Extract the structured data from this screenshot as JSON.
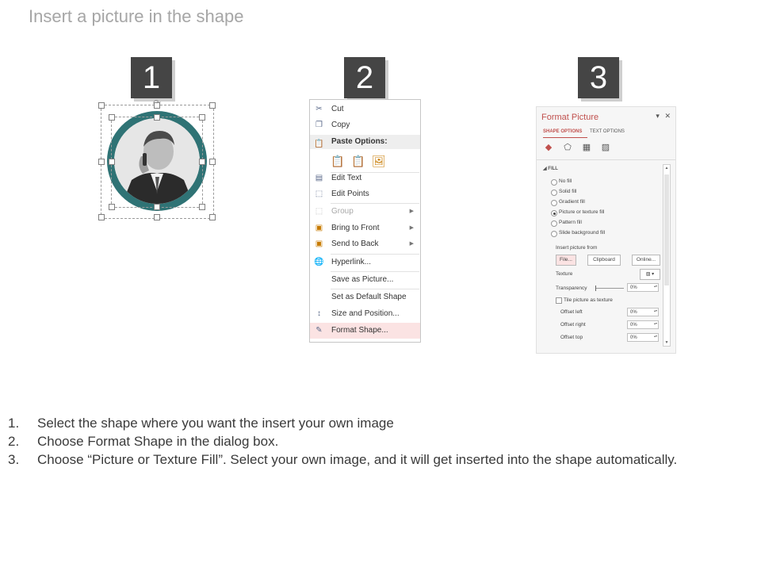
{
  "title": "Insert a picture in the shape",
  "badges": [
    "1",
    "2",
    "3"
  ],
  "context_menu": {
    "items": [
      {
        "label": "Cut",
        "icon": "scissors-icon"
      },
      {
        "label": "Copy",
        "icon": "copy-icon"
      },
      {
        "label": "Paste Options:",
        "icon": "paste-icon"
      },
      {
        "label": "Edit Text",
        "icon": "edit-text-icon"
      },
      {
        "label": "Edit Points",
        "icon": "edit-points-icon"
      },
      {
        "label": "Group",
        "icon": "group-icon",
        "disabled": true,
        "submenu": true
      },
      {
        "label": "Bring to Front",
        "icon": "bring-to-front-icon",
        "submenu": true
      },
      {
        "label": "Send to Back",
        "icon": "send-to-back-icon",
        "submenu": true
      },
      {
        "label": "Hyperlink...",
        "icon": "hyperlink-icon"
      },
      {
        "label": "Save as Picture...",
        "icon": ""
      },
      {
        "label": "Set as Default Shape",
        "icon": ""
      },
      {
        "label": "Size and Position...",
        "icon": "size-position-icon"
      },
      {
        "label": "Format Shape...",
        "icon": "format-shape-icon",
        "highlighted": true
      }
    ]
  },
  "format_pane": {
    "title": "Format Picture",
    "tabs": [
      "SHAPE OPTIONS",
      "TEXT OPTIONS"
    ],
    "section": "FILL",
    "fill_options": [
      "No fill",
      "Solid fill",
      "Gradient fill",
      "Picture or texture fill",
      "Pattern fill",
      "Slide background fill"
    ],
    "selected_fill": "Picture or texture fill",
    "insert_from": "Insert picture from",
    "buttons": [
      "File...",
      "Clipboard",
      "Online..."
    ],
    "texture": "Texture",
    "transparency": "Transparency",
    "transparency_value": "0%",
    "tile": "Tile picture as texture",
    "offsets": [
      {
        "label": "Offset left",
        "value": "0%"
      },
      {
        "label": "Offset right",
        "value": "0%"
      },
      {
        "label": "Offset top",
        "value": "0%"
      }
    ]
  },
  "steps": [
    {
      "num": "1.",
      "text": "Select the shape where you want the insert your own image"
    },
    {
      "num": "2.",
      "text": "Choose Format Shape in the dialog box."
    },
    {
      "num": "3.",
      "text": "Choose “Picture or Texture Fill”. Select your own image, and it will get inserted into the shape automatically."
    }
  ]
}
